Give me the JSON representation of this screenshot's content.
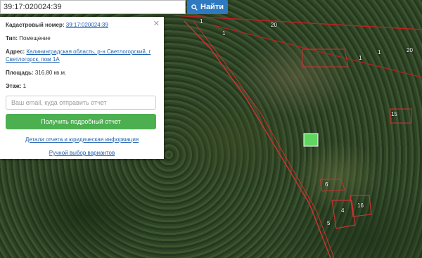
{
  "search": {
    "value": "39:17:020024:39",
    "button_label": "Найти"
  },
  "card": {
    "cadastral_label": "Кадастровый номер:",
    "cadastral_value": "39:17:020024:39",
    "type_label": "Тип:",
    "type_value": "Помещение",
    "address_label": "Адрес:",
    "address_value_line1": "Калининградская область, р-н Светлогорский, г",
    "address_value_line2": "Светлогорск, пом 1А",
    "area_label": "Площадь:",
    "area_value": "316.80 кв.м.",
    "floor_label": "Этаж:",
    "floor_value": "1",
    "email_placeholder": "Ваш email, куда отправить отчет",
    "report_button": "Получить подробный отчет",
    "details_link": "Детали отчета и юридическая информация",
    "manual_link": "Ручной выбор вариантов"
  },
  "map_labels": [
    "1",
    "1",
    "20",
    "1",
    "20",
    "1",
    "15",
    "6",
    "4",
    "16",
    "5"
  ]
}
